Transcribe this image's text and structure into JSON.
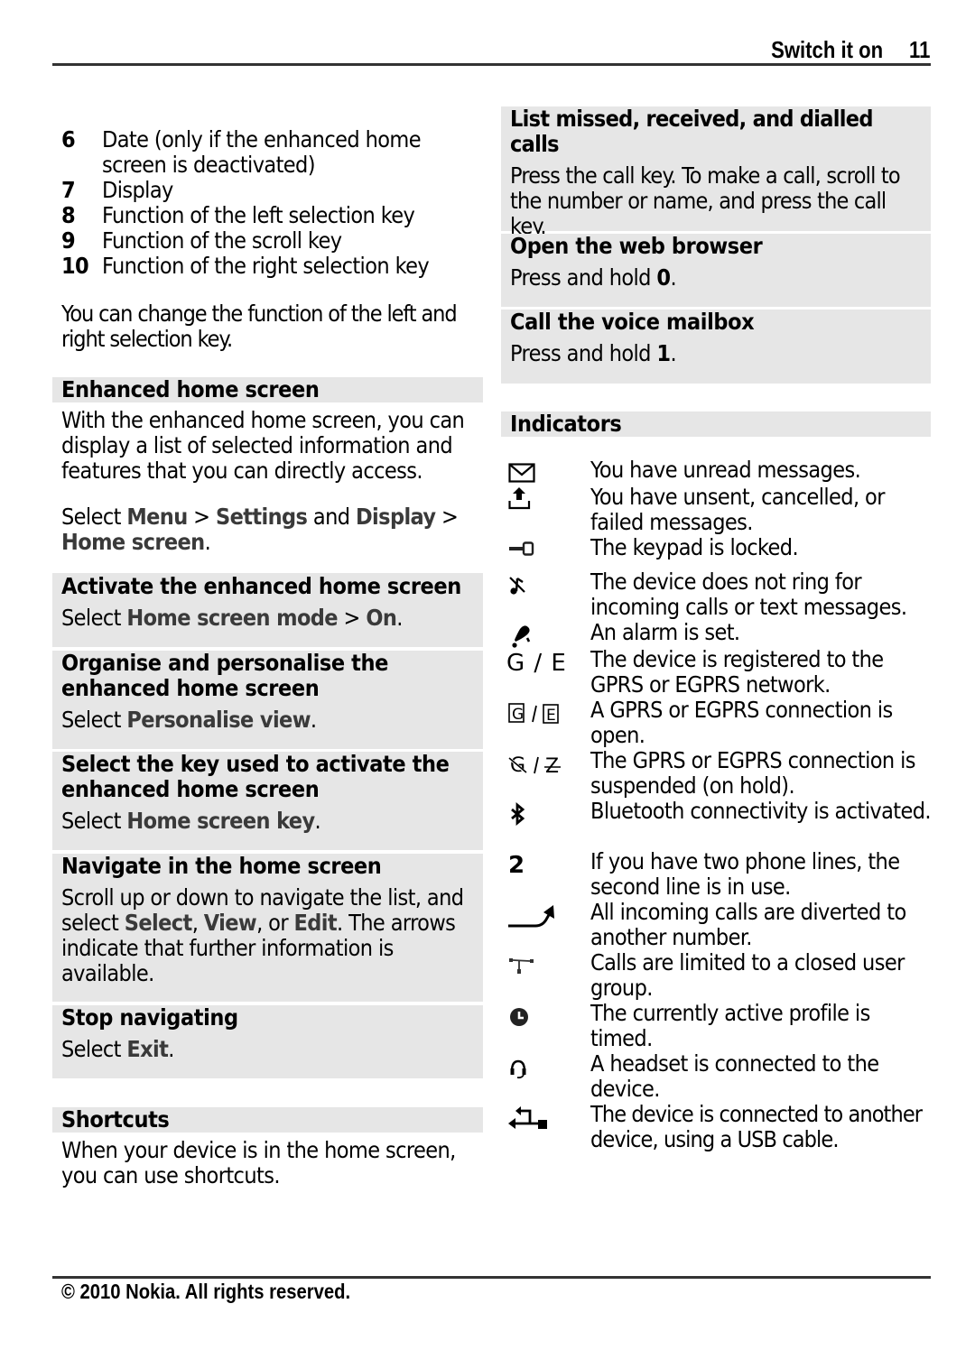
{
  "header": {
    "title": "Switch it on",
    "page_number": "11"
  },
  "footer": {
    "copyright": "© 2010 Nokia. All rights reserved."
  },
  "left_column": {
    "numbered_items": [
      {
        "num": "6",
        "lines": [
          "Date (only if the enhanced home",
          "screen is deactivated)"
        ]
      },
      {
        "num": "7",
        "lines": [
          "Display"
        ]
      },
      {
        "num": "8",
        "lines": [
          "Function of the left selection key"
        ]
      },
      {
        "num": "9",
        "lines": [
          "Function of the scroll key"
        ]
      },
      {
        "num": "10",
        "lines": [
          "Function of the right selection key"
        ]
      }
    ],
    "change_note": "You can change the function of the left and right selection key.",
    "enhanced": {
      "heading": "Enhanced home screen",
      "body": "With the enhanced home screen, you can display a list of selected information and features that you can directly access.",
      "path_prefix": "Select ",
      "path_menu": "Menu",
      "path_sep1": " > ",
      "path_settings": "Settings",
      "path_and": " and ",
      "path_display": "Display",
      "path_sep2": " > ",
      "path_home": "Home screen",
      "path_end": "."
    },
    "tasks": [
      {
        "title": "Activate the enhanced home screen",
        "prefix": "Select ",
        "ui1": "Home screen mode",
        "sep": " > ",
        "ui2": "On",
        "end": "."
      },
      {
        "title_lines": [
          "Organise and personalise the",
          "enhanced home screen"
        ],
        "prefix": "Select ",
        "ui1": "Personalise view",
        "end": "."
      },
      {
        "title_lines": [
          "Select the key used to activate the",
          "enhanced home screen"
        ],
        "prefix": "Select ",
        "ui1": "Home screen key",
        "end": "."
      },
      {
        "title": "Navigate in the home screen",
        "body_start": "Scroll up or down to navigate the list, and select ",
        "ui_select": "Select",
        "comma": ", ",
        "ui_view": "View",
        "or": ", or ",
        "ui_edit": "Edit",
        "body_end": ". The arrows indicate that further information is available."
      },
      {
        "title": "Stop navigating",
        "prefix": "Select ",
        "ui1": "Exit",
        "end": "."
      }
    ],
    "shortcuts": {
      "heading": "Shortcuts",
      "body": "When your device is in the home screen, you can use shortcuts."
    }
  },
  "right_column": {
    "shortcut_tasks": [
      {
        "title": "List missed, received, and dialled calls",
        "body": "Press the call key. To make a call, scroll to the number or name, and press the call key."
      },
      {
        "title": "Open the web browser",
        "prefix": "Press and hold ",
        "key": "0",
        "end": "."
      },
      {
        "title": "Call the voice mailbox",
        "prefix": "Press and hold ",
        "key": "1",
        "end": "."
      }
    ],
    "indicators": {
      "heading": "Indicators",
      "items": [
        {
          "icon": "envelope-icon",
          "text": "You have unread messages."
        },
        {
          "icon": "outbox-upload-icon",
          "text": "You have unsent, cancelled, or failed messages."
        },
        {
          "icon": "key-lock-icon",
          "text": "The keypad is locked."
        },
        {
          "icon": "silent-note-icon",
          "text": "The device does not ring for incoming calls or text messages."
        },
        {
          "icon": "alarm-bell-icon",
          "text": "An alarm is set."
        },
        {
          "icon": "gprs-egprs-registered-icon",
          "glyph": "G / E",
          "text": "The device is registered to the GPRS or EGPRS network."
        },
        {
          "icon": "gprs-egprs-open-icon",
          "text": "A GPRS or EGPRS connection is open."
        },
        {
          "icon": "gprs-egprs-suspended-icon",
          "text": "The GPRS or EGPRS connection is suspended (on hold)."
        },
        {
          "icon": "bluetooth-icon",
          "text": "Bluetooth connectivity is activated."
        },
        {
          "icon": "line-two-icon",
          "glyph": "2",
          "text": "If you have two phone lines, the second line is in use."
        },
        {
          "icon": "call-divert-icon",
          "text": "All incoming calls are diverted to another number."
        },
        {
          "icon": "closed-user-group-icon",
          "text": "Calls are limited to a closed user group."
        },
        {
          "icon": "timed-profile-icon",
          "text": "The currently active profile is timed."
        },
        {
          "icon": "headset-icon",
          "text": "A headset is connected to the device."
        },
        {
          "icon": "usb-icon",
          "text": "The device is connected to another device, using a USB cable."
        }
      ]
    }
  }
}
